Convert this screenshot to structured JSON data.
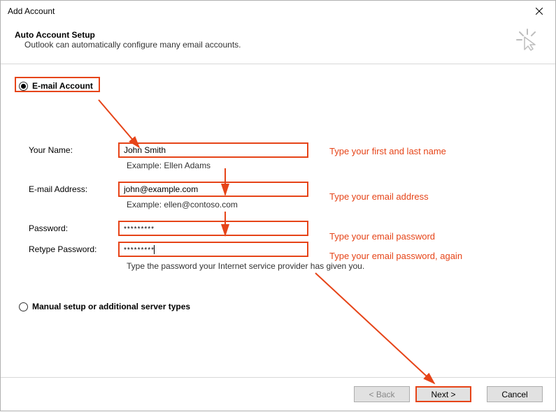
{
  "window": {
    "title": "Add Account"
  },
  "header": {
    "title": "Auto Account Setup",
    "subtitle": "Outlook can automatically configure many email accounts."
  },
  "radios": {
    "email_account": "E-mail Account",
    "manual": "Manual setup or additional server types"
  },
  "form": {
    "name_label": "Your Name:",
    "name_value": "John Smith",
    "name_example": "Example: Ellen Adams",
    "email_label": "E-mail Address:",
    "email_value": "john@example.com",
    "email_example": "Example: ellen@contoso.com",
    "password_label": "Password:",
    "password_value": "*********",
    "retype_label": "Retype Password:",
    "retype_value": "*********",
    "password_note": "Type the password your Internet service provider has given you."
  },
  "hints": {
    "name": "Type your first and last name",
    "email": "Type your email address",
    "password": "Type your email password",
    "retype": "Type your email password, again"
  },
  "buttons": {
    "back": "< Back",
    "next": "Next >",
    "cancel": "Cancel"
  }
}
